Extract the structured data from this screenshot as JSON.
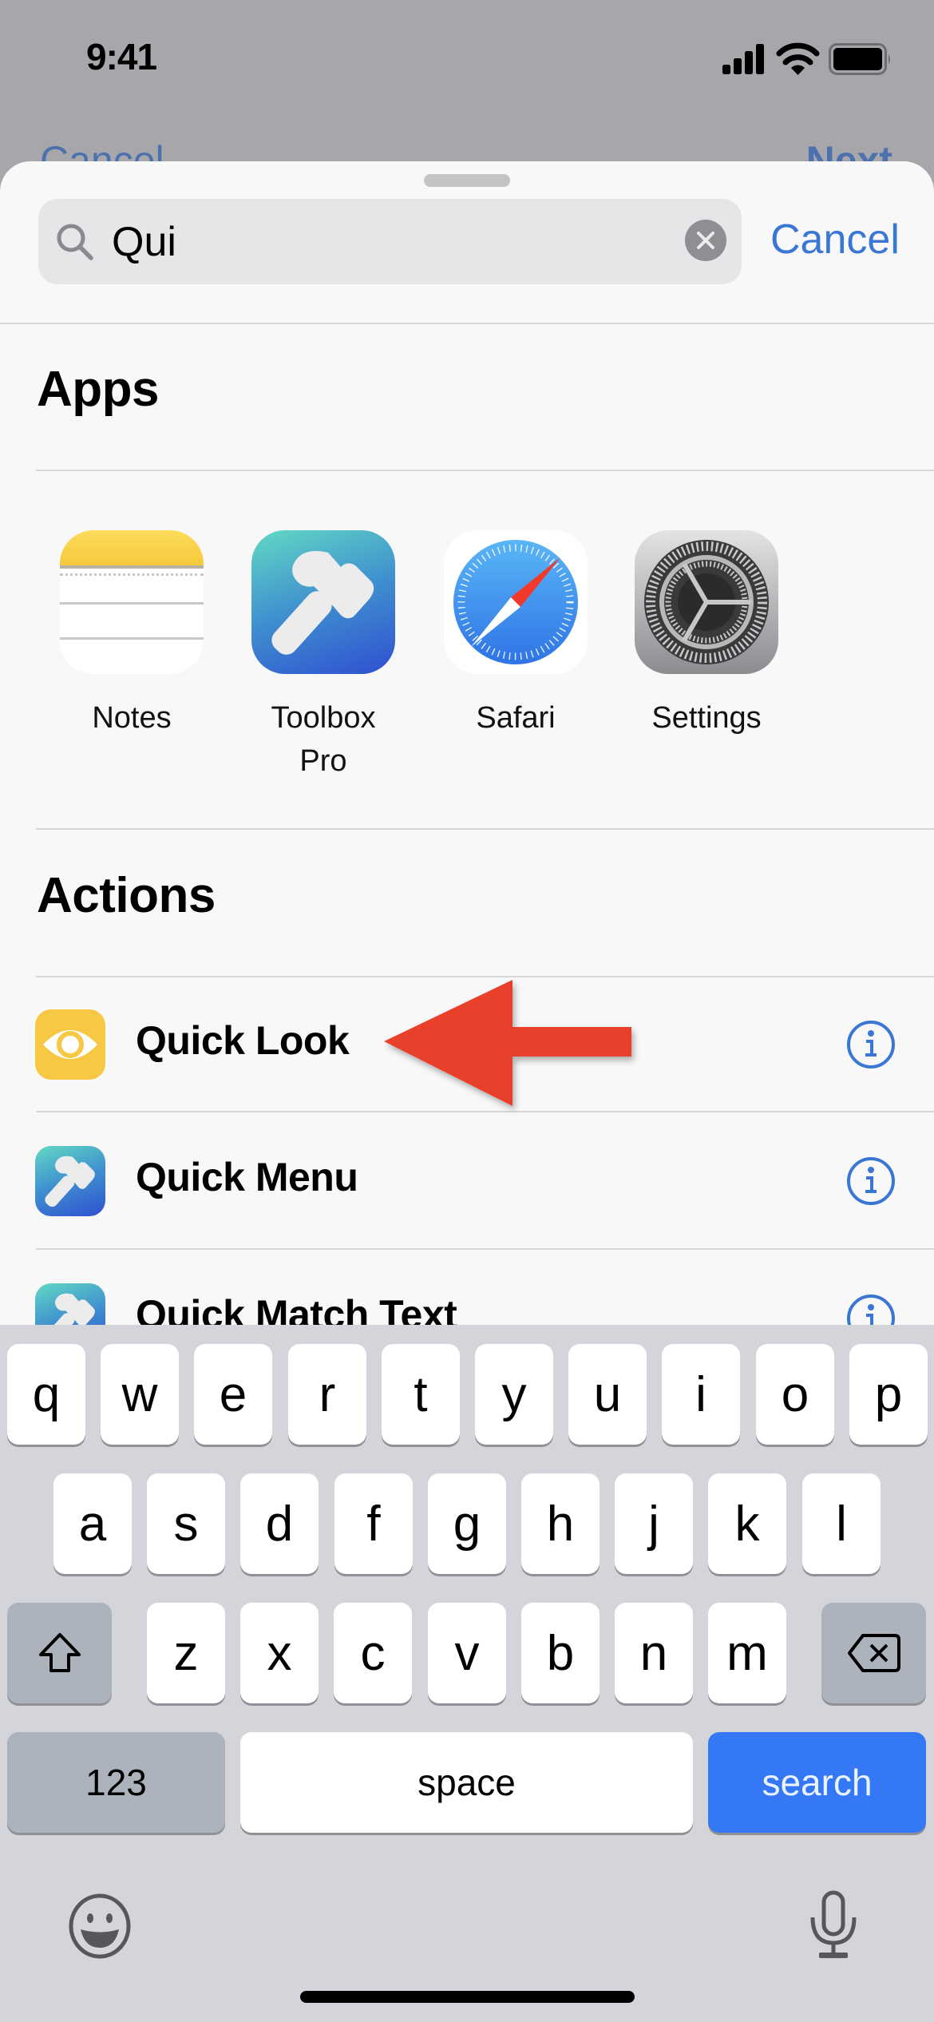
{
  "status_bar": {
    "time": "9:41",
    "icons": [
      "cellular-signal-icon",
      "wifi-icon",
      "battery-icon"
    ]
  },
  "background_nav": {
    "left_label": "Cancel",
    "right_label": "Next"
  },
  "search": {
    "value": "Qui",
    "placeholder": "Search",
    "cancel_label": "Cancel",
    "icon": "search-icon",
    "clear_icon": "clear-icon"
  },
  "apps_section": {
    "title": "Apps",
    "items": [
      {
        "label": "Notes",
        "icon": "notes-app-icon"
      },
      {
        "label": "Toolbox\nPro",
        "label_line1": "Toolbox",
        "label_line2": "Pro",
        "icon": "toolbox-pro-app-icon"
      },
      {
        "label": "Safari",
        "icon": "safari-app-icon"
      },
      {
        "label": "Settings",
        "icon": "settings-app-icon"
      }
    ]
  },
  "actions_section": {
    "title": "Actions",
    "items": [
      {
        "label": "Quick Look",
        "icon": "eye-icon",
        "info_icon": "info-icon"
      },
      {
        "label": "Quick Menu",
        "icon": "toolbox-pro-icon",
        "info_icon": "info-icon"
      },
      {
        "label": "Quick Match Text",
        "icon": "toolbox-pro-icon",
        "info_icon": "info-icon"
      }
    ]
  },
  "annotation": {
    "type": "arrow",
    "points_to": "Quick Look",
    "color": "#e8402a"
  },
  "keyboard": {
    "row1": [
      "q",
      "w",
      "e",
      "r",
      "t",
      "y",
      "u",
      "i",
      "o",
      "p"
    ],
    "row2": [
      "a",
      "s",
      "d",
      "f",
      "g",
      "h",
      "j",
      "k",
      "l"
    ],
    "row3": [
      "z",
      "x",
      "c",
      "v",
      "b",
      "n",
      "m"
    ],
    "shift_icon": "shift-icon",
    "delete_icon": "delete-icon",
    "numbers_label": "123",
    "space_label": "space",
    "return_label": "search",
    "emoji_icon": "emoji-icon",
    "mic_icon": "microphone-icon"
  },
  "colors": {
    "accent": "#3a77d4",
    "search_key": "#3478f6",
    "arrow": "#e8402a",
    "quick_look_icon": "#f7c844"
  }
}
